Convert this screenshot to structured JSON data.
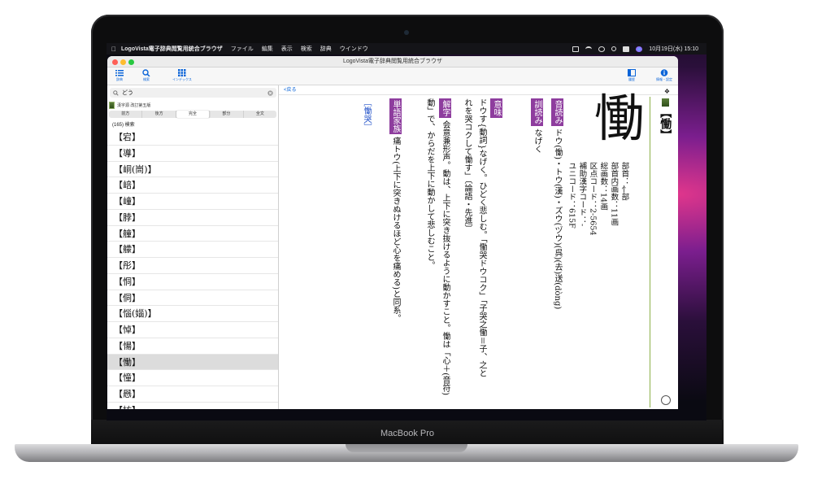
{
  "laptop": {
    "brand": "MacBook Pro"
  },
  "menubar": {
    "app_name": "LogoVista電子辞典閲覧用統合ブラウザ",
    "items": [
      "ファイル",
      "編集",
      "表示",
      "検索",
      "辞典",
      "ウインドウ"
    ],
    "datetime": "10月19日(水) 15:10"
  },
  "window": {
    "title": "LogoVista電子辞典閲覧用統合ブラウザ",
    "traffic_colors": [
      "#ff5f57",
      "#febc2e",
      "#28c840"
    ]
  },
  "toolbar": {
    "left": [
      {
        "label": "辞典",
        "icon": "list-icon"
      },
      {
        "label": "検索",
        "icon": "search-icon"
      },
      {
        "label": "インデックス",
        "icon": "grid-icon"
      }
    ],
    "right": [
      {
        "label": "履歴",
        "icon": "history-icon"
      },
      {
        "label": "情報・設定",
        "icon": "info-icon"
      }
    ],
    "accent": "#0a64d8"
  },
  "sidebar": {
    "search_value": "どう",
    "dictionary": "漢字源 改訂第五版",
    "segments": [
      "前方",
      "後方",
      "完全",
      "部分",
      "全文"
    ],
    "active_segment": "完全",
    "result_count": "(165) 検索",
    "results": [
      "【宕】",
      "【導】",
      "【峒(峝)】",
      "【㟝】",
      "【㠉】",
      "【脖】",
      "【艟】",
      "【艨】",
      "【彤】",
      "【恫】",
      "【侗】",
      "【惱(㛴)】",
      "【悼】",
      "【愓】",
      "【慟】",
      "【憧】",
      "【㦛】",
      "【㧍】"
    ],
    "selected_result": "【慟】"
  },
  "content": {
    "back_label": "<戻る",
    "headword": "【慟】",
    "kanji": "慟",
    "meta": [
      "部首：忄部",
      "部首内画数：11画",
      "総画数：14画",
      "区点コード：2-5654",
      "補助漢字コード：-",
      "ユニコード：615F"
    ],
    "reading_tag": "音読み",
    "reading": "ドウ(慟)・トウ(漢)・ズウ(ヅウ)(呉)(去)送(dòng)",
    "kun_tag": "訓読み",
    "kun": "なげく",
    "meaning_tag": "意味",
    "meaning_1": "ドウす{動詞}なげく。ひどく悲しむ。「慟哭ドウコク」「子哭之慟＝子、之と",
    "meaning_2": "れを哭コクして慟す」〔論語・先進〕",
    "kaiji_tag": "解字",
    "kaiji_1": "会意兼形声。動は、上下に突き抜けるように動かすこと。慟は「心＋(音符)",
    "kaiji_2": "動」で、からだを上下に動かして悲しむこと。",
    "family_tag": "単語家族",
    "family": "痛トウ(上下に突きぬけるほど心を痛める)と同系。",
    "related_link": "［慟哭］",
    "line_color": "#8cb04a",
    "tag_color": "#8e3d9e"
  }
}
